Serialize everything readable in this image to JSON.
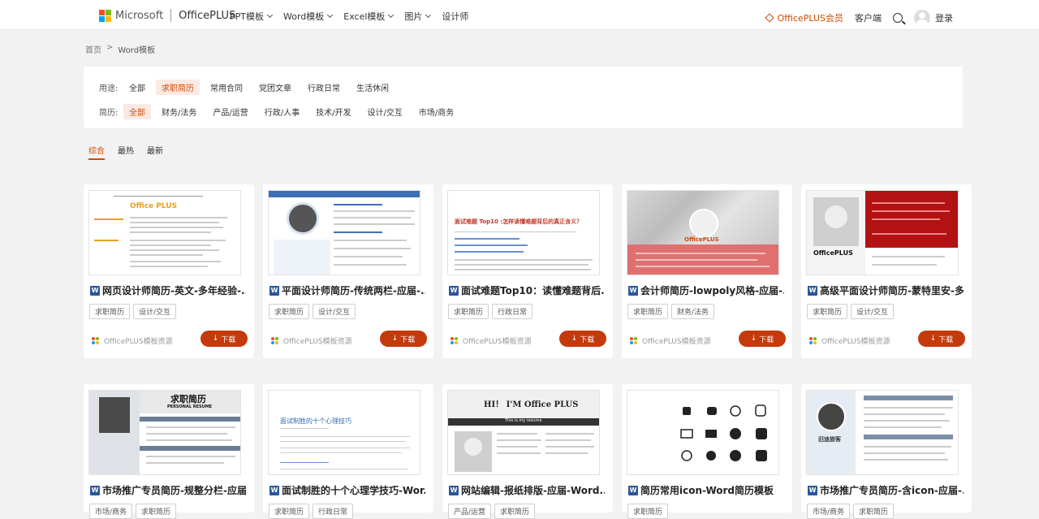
{
  "header": {
    "brand_ms": "Microsoft",
    "brand_op": "OfficePLUS",
    "nav": [
      "PPT模板",
      "Word模板",
      "Excel模板",
      "图片",
      "设计师"
    ],
    "nav_has_dropdown": [
      true,
      true,
      true,
      true,
      false
    ],
    "member": "OfficePLUS会员",
    "client": "客户端",
    "login": "登录"
  },
  "breadcrumb": {
    "home": "首页",
    "sep": ">",
    "current": "Word模板"
  },
  "filters": {
    "usage_label": "用途:",
    "usage": [
      "全部",
      "求职简历",
      "常用合同",
      "党团文章",
      "行政日常",
      "生活休闲"
    ],
    "usage_active": 1,
    "resume_label": "简历:",
    "resume": [
      "全部",
      "财务/法务",
      "产品/运营",
      "行政/人事",
      "技术/开发",
      "设计/交互",
      "市场/商务"
    ],
    "resume_active": 0
  },
  "sort": {
    "tabs": [
      "综合",
      "最热",
      "最新"
    ],
    "active": 0
  },
  "download_label": "下载",
  "cards": [
    {
      "title": "网页设计师简历-英文-多年经验-...",
      "tags": [
        "求职简历",
        "设计/交互"
      ],
      "source": "OfficePLUS模板资源"
    },
    {
      "title": "平面设计师简历-传统两栏-应届-...",
      "tags": [
        "求职简历",
        "设计/交互"
      ],
      "source": "OfficePLUS模板资源"
    },
    {
      "title": "面试难题Top10：读懂难题背后...",
      "tags": [
        "求职简历",
        "行政日常"
      ],
      "source": "OfficePLUS模板资源"
    },
    {
      "title": "会计师简历-lowpoly风格-应届-...",
      "tags": [
        "求职简历",
        "财务/法务"
      ],
      "source": "OfficePLUS模板资源"
    },
    {
      "title": "高级平面设计师简历-蒙特里安-多...",
      "tags": [
        "求职简历",
        "设计/交互"
      ],
      "source": "OfficePLUS模板资源"
    },
    {
      "title": "市场推广专员简历-规整分栏-应届...",
      "tags": [
        "市场/商务",
        "求职简历"
      ],
      "source": ""
    },
    {
      "title": "面试制胜的十个心理学技巧-Wor...",
      "tags": [
        "求职简历",
        "行政日常"
      ],
      "source": ""
    },
    {
      "title": "网站编辑-报纸排版-应届-Word...",
      "tags": [
        "产品/运营",
        "求职简历"
      ],
      "source": ""
    },
    {
      "title": "简历常用icon-Word简历模板",
      "tags": [
        "求职简历"
      ],
      "source": ""
    },
    {
      "title": "市场推广专员简历-含icon-应届-...",
      "tags": [
        "市场/商务",
        "求职简历"
      ],
      "source": ""
    }
  ],
  "thumb_text": {
    "t1": "Office PLUS",
    "t3": "面试难题 Top10 :怎样读懂难题背后的真正含义？",
    "t4": "OfficePLUS",
    "t5": "OfficePLUS",
    "t6": "求职简历",
    "t6b": "PERSONAL   RESUME",
    "t7": "面试制胜的十个心理技巧",
    "t8": "HI！ I'M Office PLUS",
    "t8b": "This is my resume",
    "t10": "旧迪旅客"
  },
  "colors": {
    "accent": "#d04a02",
    "download_bg": "#c43a0c",
    "word_blue": "#2b579a"
  }
}
